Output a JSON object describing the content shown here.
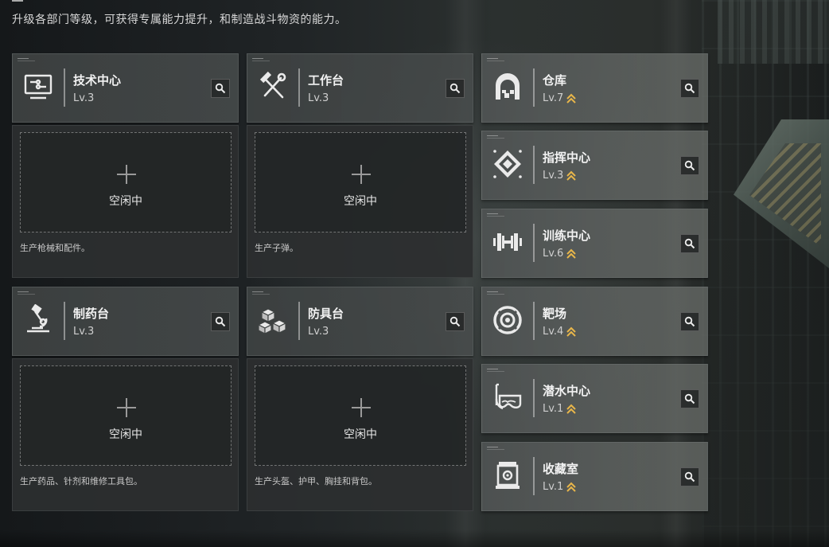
{
  "header": {
    "description": "升级各部门等级，可获得专属能力提升，和制造战斗物资的能力。"
  },
  "departments": [
    {
      "id": "tech",
      "name": "技术中心",
      "level": "Lv.3",
      "icon": "computer-monitor-icon",
      "upgradable": false,
      "slot": {
        "status": "空闲中",
        "description": "生产枪械和配件。"
      }
    },
    {
      "id": "workbench",
      "name": "工作台",
      "level": "Lv.3",
      "icon": "hammer-wrench-icon",
      "upgradable": false,
      "slot": {
        "status": "空闲中",
        "description": "生产子弹。"
      }
    },
    {
      "id": "pharmacy",
      "name": "制药台",
      "level": "Lv.3",
      "icon": "microscope-icon",
      "upgradable": false,
      "slot": {
        "status": "空闲中",
        "description": "生产药品、针剂和维修工具包。"
      }
    },
    {
      "id": "armor",
      "name": "防具台",
      "level": "Lv.3",
      "icon": "armor-cubes-icon",
      "upgradable": false,
      "slot": {
        "status": "空闲中",
        "description": "生产头盔、护甲、胸挂和背包。"
      }
    },
    {
      "id": "warehouse",
      "name": "仓库",
      "level": "Lv.7",
      "icon": "warehouse-icon",
      "upgradable": true
    },
    {
      "id": "command",
      "name": "指挥中心",
      "level": "Lv.3",
      "icon": "command-diamond-icon",
      "upgradable": true
    },
    {
      "id": "training",
      "name": "训练中心",
      "level": "Lv.6",
      "icon": "dumbbell-icon",
      "upgradable": true
    },
    {
      "id": "range",
      "name": "靶场",
      "level": "Lv.4",
      "icon": "target-icon",
      "upgradable": true
    },
    {
      "id": "diving",
      "name": "潜水中心",
      "level": "Lv.1",
      "icon": "diving-mask-icon",
      "upgradable": true
    },
    {
      "id": "collection",
      "name": "收藏室",
      "level": "Lv.1",
      "icon": "display-case-icon",
      "upgradable": true
    }
  ],
  "colors": {
    "upgrade_arrow": "#e8b64a",
    "card_bg": "#474b4b",
    "panel_bg": "#2c2f30"
  }
}
